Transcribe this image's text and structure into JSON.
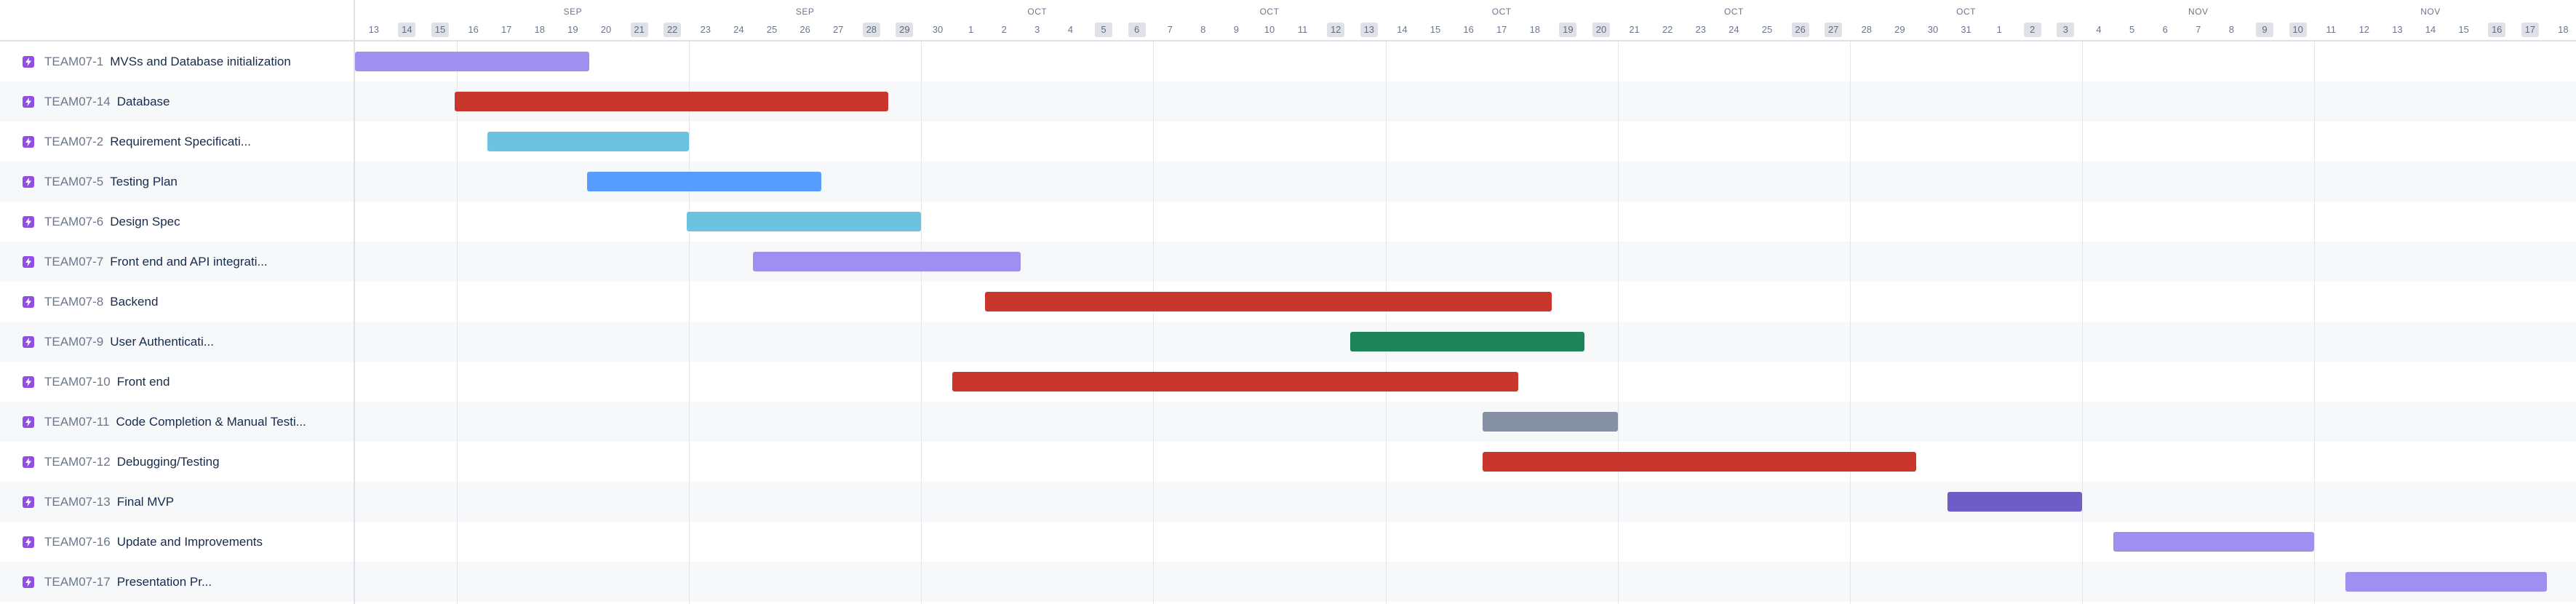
{
  "colors": {
    "purple_light": "#9f8fef",
    "red": "#c9372c",
    "teal": "#6cc3e0",
    "blue": "#579dff",
    "green": "#1f845a",
    "gray": "#8590a2",
    "purple_dark": "#6e5dc6",
    "issue_type_icon": "#904ee2"
  },
  "timeline": {
    "month_labels": [
      "SEP",
      "SEP",
      "OCT",
      "OCT",
      "OCT",
      "OCT",
      "OCT",
      "NOV",
      "NOV"
    ],
    "days": [
      {
        "label": "13",
        "weekend": false
      },
      {
        "label": "14",
        "weekend": true
      },
      {
        "label": "15",
        "weekend": true
      },
      {
        "label": "16",
        "weekend": false
      },
      {
        "label": "17",
        "weekend": false
      },
      {
        "label": "18",
        "weekend": false
      },
      {
        "label": "19",
        "weekend": false
      },
      {
        "label": "20",
        "weekend": false
      },
      {
        "label": "21",
        "weekend": true
      },
      {
        "label": "22",
        "weekend": true
      },
      {
        "label": "23",
        "weekend": false
      },
      {
        "label": "24",
        "weekend": false
      },
      {
        "label": "25",
        "weekend": false
      },
      {
        "label": "26",
        "weekend": false
      },
      {
        "label": "27",
        "weekend": false
      },
      {
        "label": "28",
        "weekend": true
      },
      {
        "label": "29",
        "weekend": true
      },
      {
        "label": "30",
        "weekend": false
      },
      {
        "label": "1",
        "weekend": false
      },
      {
        "label": "2",
        "weekend": false
      },
      {
        "label": "3",
        "weekend": false
      },
      {
        "label": "4",
        "weekend": false
      },
      {
        "label": "5",
        "weekend": true
      },
      {
        "label": "6",
        "weekend": true
      },
      {
        "label": "7",
        "weekend": false
      },
      {
        "label": "8",
        "weekend": false
      },
      {
        "label": "9",
        "weekend": false
      },
      {
        "label": "10",
        "weekend": false
      },
      {
        "label": "11",
        "weekend": false
      },
      {
        "label": "12",
        "weekend": true
      },
      {
        "label": "13",
        "weekend": true
      },
      {
        "label": "14",
        "weekend": false
      },
      {
        "label": "15",
        "weekend": false
      },
      {
        "label": "16",
        "weekend": false
      },
      {
        "label": "17",
        "weekend": false
      },
      {
        "label": "18",
        "weekend": false
      },
      {
        "label": "19",
        "weekend": true
      },
      {
        "label": "20",
        "weekend": true
      },
      {
        "label": "21",
        "weekend": false
      },
      {
        "label": "22",
        "weekend": false
      },
      {
        "label": "23",
        "weekend": false
      },
      {
        "label": "24",
        "weekend": false
      },
      {
        "label": "25",
        "weekend": false
      },
      {
        "label": "26",
        "weekend": true
      },
      {
        "label": "27",
        "weekend": true
      },
      {
        "label": "28",
        "weekend": false
      },
      {
        "label": "29",
        "weekend": false
      },
      {
        "label": "30",
        "weekend": false
      },
      {
        "label": "31",
        "weekend": false
      },
      {
        "label": "1",
        "weekend": false
      },
      {
        "label": "2",
        "weekend": true
      },
      {
        "label": "3",
        "weekend": true
      },
      {
        "label": "4",
        "weekend": false
      },
      {
        "label": "5",
        "weekend": false
      },
      {
        "label": "6",
        "weekend": false
      },
      {
        "label": "7",
        "weekend": false
      },
      {
        "label": "8",
        "weekend": false
      },
      {
        "label": "9",
        "weekend": true
      },
      {
        "label": "10",
        "weekend": true
      },
      {
        "label": "11",
        "weekend": false
      },
      {
        "label": "12",
        "weekend": false
      },
      {
        "label": "13",
        "weekend": false
      },
      {
        "label": "14",
        "weekend": false
      },
      {
        "label": "15",
        "weekend": false
      },
      {
        "label": "16",
        "weekend": true
      },
      {
        "label": "17",
        "weekend": true
      },
      {
        "label": "18",
        "weekend": false
      }
    ]
  },
  "issues": [
    {
      "key": "TEAM07-1",
      "summary": "MVSs and Database initialization",
      "start": "Sep 13",
      "end": "Sep 20",
      "color": "purple_light"
    },
    {
      "key": "TEAM07-14",
      "summary": "Database",
      "start": "Sep 16",
      "end": "Sep 29",
      "color": "red"
    },
    {
      "key": "TEAM07-2",
      "summary": "Requirement Specificati...",
      "start": "Sep 17",
      "end": "Sep 23",
      "color": "teal"
    },
    {
      "key": "TEAM07-5",
      "summary": "Testing Plan",
      "start": "Sep 20",
      "end": "Sep 27",
      "color": "blue"
    },
    {
      "key": "TEAM07-6",
      "summary": "Design Spec",
      "start": "Sep 23",
      "end": "Sep 30",
      "color": "teal"
    },
    {
      "key": "TEAM07-7",
      "summary": "Front end and API integrati...",
      "start": "Sep 25",
      "end": "Oct 3",
      "color": "purple_light"
    },
    {
      "key": "TEAM07-8",
      "summary": "Backend",
      "start": "Oct 2",
      "end": "Oct 19",
      "color": "red"
    },
    {
      "key": "TEAM07-9",
      "summary": "User Authenticati...",
      "start": "Oct 13",
      "end": "Oct 20",
      "color": "green"
    },
    {
      "key": "TEAM07-10",
      "summary": "Front end",
      "start": "Oct 1",
      "end": "Oct 18",
      "color": "red"
    },
    {
      "key": "TEAM07-11",
      "summary": "Code Completion & Manual Testi...",
      "start": "Oct 17",
      "end": "Oct 21",
      "color": "gray"
    },
    {
      "key": "TEAM07-12",
      "summary": "Debugging/Testing",
      "start": "Oct 17",
      "end": "Oct 30",
      "color": "red"
    },
    {
      "key": "TEAM07-13",
      "summary": "Final MVP",
      "start": "Oct 31",
      "end": "Nov 4",
      "color": "purple_dark"
    },
    {
      "key": "TEAM07-16",
      "summary": "Update and Improvements",
      "start": "Nov 5",
      "end": "Nov 11",
      "color": "purple_light"
    },
    {
      "key": "TEAM07-17",
      "summary": "Presentation Pr...",
      "start": "Nov 12",
      "end": "Nov 18",
      "color": "purple_light"
    }
  ]
}
